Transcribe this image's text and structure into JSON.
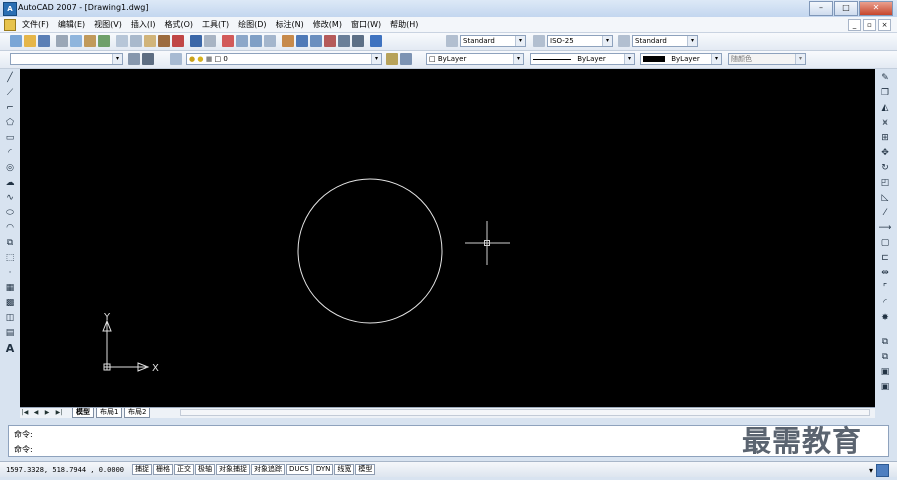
{
  "window": {
    "title": "AutoCAD 2007 - [Drawing1.dwg]",
    "app_icon_text": "A",
    "min": "–",
    "max": "□",
    "close": "✕"
  },
  "menu": [
    "文件(F)",
    "编辑(E)",
    "视图(V)",
    "插入(I)",
    "格式(O)",
    "工具(T)",
    "绘图(D)",
    "标注(N)",
    "修改(M)",
    "窗口(W)",
    "帮助(H)"
  ],
  "mdi": {
    "min": "_",
    "restore": "▫",
    "close": "×"
  },
  "styles": {
    "text_style": "Standard",
    "dim_style": "ISO-25",
    "table_style": "Standard"
  },
  "layers": {
    "current_layer": "0"
  },
  "properties": {
    "color": "ByLayer",
    "linetype": "ByLayer",
    "lineweight": "ByLayer",
    "plotstyle": "随颜色"
  },
  "canvas": {
    "background": "#000000",
    "ucs_x": "X",
    "ucs_y": "Y"
  },
  "tabs": {
    "nav": [
      "|◀",
      "◀",
      "▶",
      "▶|"
    ],
    "items": [
      "模型",
      "布局1",
      "布局2"
    ],
    "active": "模型"
  },
  "command": {
    "line1": "命令:",
    "line2": "命令:"
  },
  "watermark": "最需教育",
  "status": {
    "coords": "1597.3328, 518.7944 , 0.0000",
    "buttons": [
      "捕捉",
      "栅格",
      "正交",
      "极轴",
      "对象捕捉",
      "对象追踪",
      "DUCS",
      "DYN",
      "线宽",
      "模型"
    ]
  },
  "colors": {
    "accent": "#2b6fb3",
    "titlebar": "#c3d6ef",
    "canvas": "#000000"
  }
}
